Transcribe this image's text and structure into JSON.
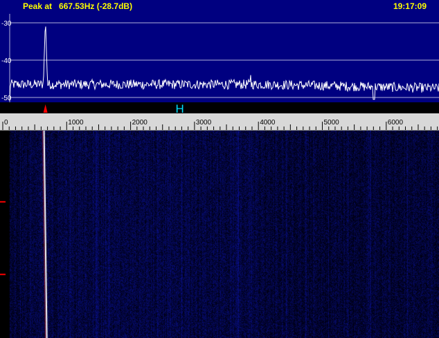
{
  "header": {
    "peak_label": "Peak at   667.53Hz (-28.7dB)",
    "clock": "19:17:09"
  },
  "spectrum": {
    "db_labels": [
      "-30",
      "-40",
      "-50"
    ],
    "db_values": [
      -30,
      -40,
      -50
    ],
    "db_range": [
      -52,
      -27
    ],
    "freq_range_hz": [
      0,
      6800
    ],
    "peak_hz": 667.53,
    "peak_db": -28.7,
    "noise_floor_db": -46.5,
    "line_color": "#ffffff",
    "background_color": "#000080",
    "grid_color": "#b0b0d8"
  },
  "markers": {
    "rx_marker_hz": 667.5,
    "rx_marker_color": "#ff0000",
    "tx_marker_hz": 2770,
    "tx_marker_glyph": "H",
    "tx_marker_color": "#00e0ff"
  },
  "ruler": {
    "tick_labels": [
      "0",
      "1000",
      "2000",
      "3000",
      "4000",
      "5000",
      "6000"
    ],
    "tick_values_hz": [
      0,
      1000,
      2000,
      3000,
      4000,
      5000,
      6000
    ],
    "minor_step_hz": 100,
    "background_color": "#d8d8d8"
  },
  "waterfall": {
    "signal_hz": 667.5,
    "signal_color": "#ffffff",
    "signal_edge_color": "#ff3030",
    "time_marker_color": "#ff0000"
  }
}
